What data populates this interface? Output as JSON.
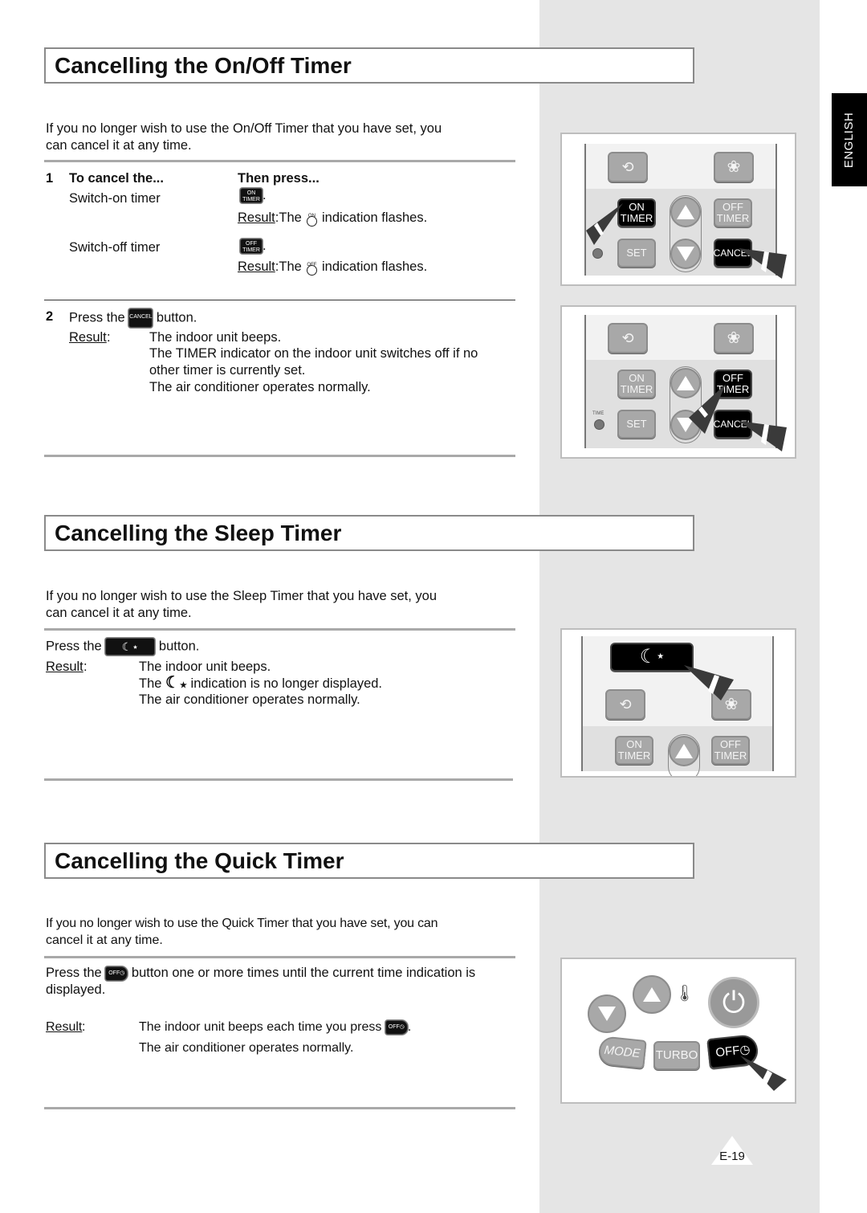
{
  "language_tab": "ENGLISH",
  "page_number": "E-19",
  "colors": {
    "side_column": "#e5e5e5",
    "rule": "#a9a9a9",
    "title_border": "#8a8a8a"
  },
  "onoff": {
    "title": "Cancelling the On/Off Timer",
    "intro_line1": "If you no longer wish to use the On/Off Timer that you have set, you",
    "intro_line2": "can cancel it at any time.",
    "step1": {
      "number": "1",
      "col1_header": "To cancel the...",
      "col2_header": "Then press...",
      "rows": [
        {
          "item": "Switch-on timer",
          "button": {
            "line1": "ON",
            "line2": "TIMER"
          },
          "period": ".",
          "result_label": "Result",
          "result_colon": ":",
          "result_pre": "The",
          "indicator_label": "ON",
          "result_post": "indication flashes."
        },
        {
          "item": "Switch-off timer",
          "button": {
            "line1": "OFF",
            "line2": "TIMER"
          },
          "period": ".",
          "result_label": "Result",
          "result_colon": ":",
          "result_pre": "The",
          "indicator_label": "OFF",
          "result_post": "indication flashes."
        }
      ]
    },
    "step2": {
      "number": "2",
      "press_pre": "Press the",
      "button": "CANCEL",
      "press_post": "button.",
      "result_label": "Result",
      "result_colon": ":",
      "results": [
        "The indoor unit beeps.",
        "The TIMER indicator on the indoor unit switches off if no",
        "other timer is currently set.",
        "The air conditioner operates normally."
      ]
    },
    "figure1": {
      "buttons": [
        "ON TIMER",
        "OFF TIMER",
        "SET",
        "CANCEL"
      ],
      "on1": "ON",
      "timer1": "TIMER",
      "off1": "OFF",
      "timer2": "TIMER",
      "set": "SET",
      "cancel": "CANCEL"
    },
    "figure2": {
      "on1": "ON",
      "timer1": "TIMER",
      "off1": "OFF",
      "timer2": "TIMER",
      "set": "SET",
      "cancel": "CANCEL",
      "time_label": "TIME"
    }
  },
  "sleep": {
    "title": "Cancelling the Sleep Timer",
    "intro_line1": "If you no longer wish to use the Sleep Timer that you have set, you",
    "intro_line2": "can cancel it at any time.",
    "press_pre": "Press the",
    "press_post": "button.",
    "result_label": "Result",
    "result_colon": ":",
    "result1": "The indoor unit beeps.",
    "result2_pre": "The",
    "result2_post": "indication is no longer displayed.",
    "result3": "The air conditioner operates normally.",
    "figure": {
      "on1": "ON",
      "timer1": "TIMER",
      "off1": "OFF",
      "timer2": "TIMER"
    }
  },
  "quick": {
    "title": "Cancelling the Quick Timer",
    "intro_line1": "If you no longer wish to use the Quick Timer that you have set, you can",
    "intro_line2": "cancel it at any time.",
    "press_pre": "Press the",
    "press_post": "button one or more times until the current time indication is",
    "press_line2": "displayed.",
    "button_label": "OFF",
    "result_label": "Result",
    "result_colon": ":",
    "result1": "The indoor unit beeps each time you press",
    "result1_end": ".",
    "result2": "The air conditioner operates normally.",
    "figure": {
      "mode": "MODE",
      "turbo": "TURBO",
      "off": "OFF"
    }
  }
}
